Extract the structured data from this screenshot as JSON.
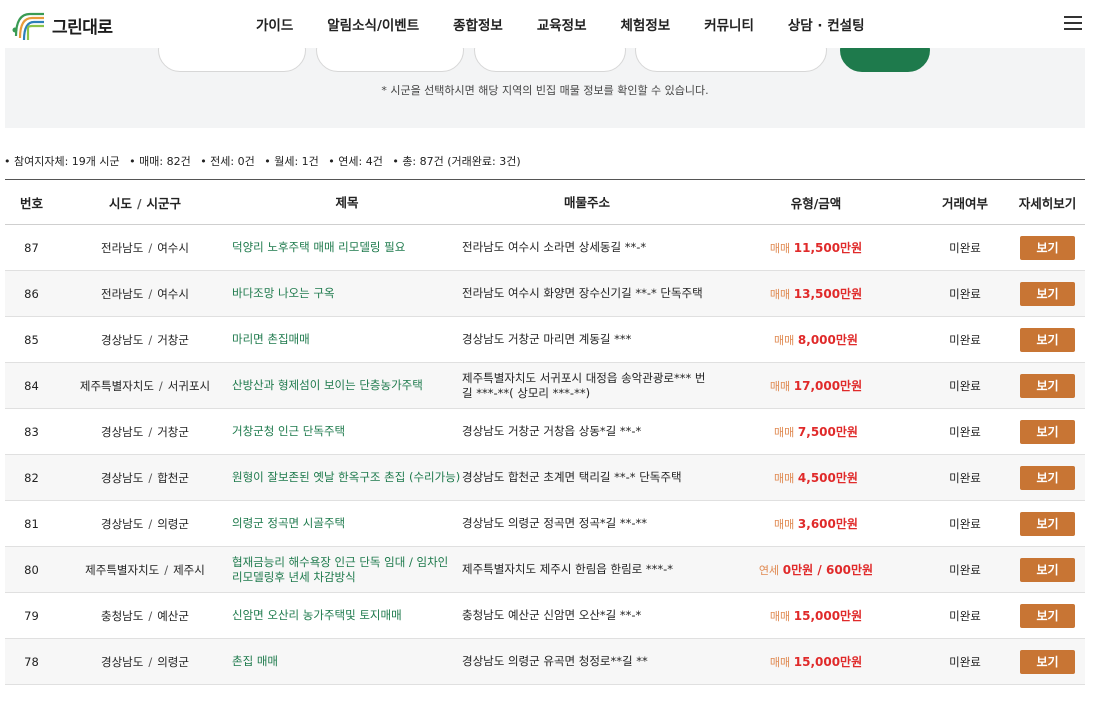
{
  "header": {
    "logo_text": "그린대로",
    "nav": [
      "가이드",
      "알림소식/이벤트",
      "종합정보",
      "교육정보",
      "체험정보",
      "커뮤니티",
      "상담 · 컨설팅"
    ]
  },
  "search": {
    "note": "* 시군을 선택하시면 해당 지역의 빈집 매물 정보를 확인할 수 있습니다."
  },
  "summary": [
    "• 참여지자체: 19개 시군",
    "• 매매: 82건",
    "• 전세: 0건",
    "• 월세: 1건",
    "• 연세: 4건",
    "• 총: 87건 (거래완료: 3건)"
  ],
  "table": {
    "headers": {
      "no": "번호",
      "sido": "시도",
      "sigungu": "시군구",
      "title": "제목",
      "address": "매물주소",
      "price": "유형/금액",
      "status": "거래여부",
      "view": "자세히보기"
    },
    "separator": "/",
    "view_label": "보기",
    "rows": [
      {
        "no": "87",
        "sido": "전라남도",
        "sigungu": "여수시",
        "title": "덕양리 노후주택 매매 리모델링 필요",
        "address": "전라남도 여수시 소라면 상세동길 **-*",
        "ptype": "매매",
        "price": "11,500만원",
        "status": "미완료"
      },
      {
        "no": "86",
        "sido": "전라남도",
        "sigungu": "여수시",
        "title": "바다조망 나오는 구옥",
        "address": "전라남도 여수시 화양면 장수신기길 **-* 단독주택",
        "ptype": "매매",
        "price": "13,500만원",
        "status": "미완료"
      },
      {
        "no": "85",
        "sido": "경상남도",
        "sigungu": "거창군",
        "title": "마리면 촌집매매",
        "address": "경상남도 거창군 마리면 계동길 ***",
        "ptype": "매매",
        "price": "8,000만원",
        "status": "미완료"
      },
      {
        "no": "84",
        "sido": "제주특별자치도",
        "sigungu": "서귀포시",
        "title": "산방산과 형제섬이 보이는 단층농가주택",
        "address": "제주특별자치도 서귀포시 대정읍 송악관광로*** 번길 ***-**( 상모리 ***-**)",
        "ptype": "매매",
        "price": "17,000만원",
        "status": "미완료"
      },
      {
        "no": "83",
        "sido": "경상남도",
        "sigungu": "거창군",
        "title": "거창군청 인근 단독주택",
        "address": "경상남도 거창군 거창읍 상동*길 **-*",
        "ptype": "매매",
        "price": "7,500만원",
        "status": "미완료"
      },
      {
        "no": "82",
        "sido": "경상남도",
        "sigungu": "합천군",
        "title": "원형이 잘보존된 옛날 한옥구조 촌집 (수리가능)",
        "address": "경상남도 합천군 초계면 택리길 **-* 단독주택",
        "ptype": "매매",
        "price": "4,500만원",
        "status": "미완료"
      },
      {
        "no": "81",
        "sido": "경상남도",
        "sigungu": "의령군",
        "title": "의령군 정곡면 시골주택",
        "address": "경상남도 의령군 정곡면 정곡*길 **-**",
        "ptype": "매매",
        "price": "3,600만원",
        "status": "미완료"
      },
      {
        "no": "80",
        "sido": "제주특별자치도",
        "sigungu": "제주시",
        "title": "협재금능리 해수욕장 인근 단독 임대 / 임차인 리모델링후 년세 차감방식",
        "address": "제주특별자치도 제주시 한림읍 한림로 ***-*",
        "ptype": "연세",
        "price": "0만원 / 600만원",
        "status": "미완료"
      },
      {
        "no": "79",
        "sido": "충청남도",
        "sigungu": "예산군",
        "title": "신암면 오산리 농가주택및 토지매매",
        "address": "충청남도 예산군 신암면 오산*길 **-*",
        "ptype": "매매",
        "price": "15,000만원",
        "status": "미완료"
      },
      {
        "no": "78",
        "sido": "경상남도",
        "sigungu": "의령군",
        "title": "촌집 매매",
        "address": "경상남도 의령군 유곡면 청정로**길 **",
        "ptype": "매매",
        "price": "15,000만원",
        "status": "미완료"
      }
    ]
  }
}
